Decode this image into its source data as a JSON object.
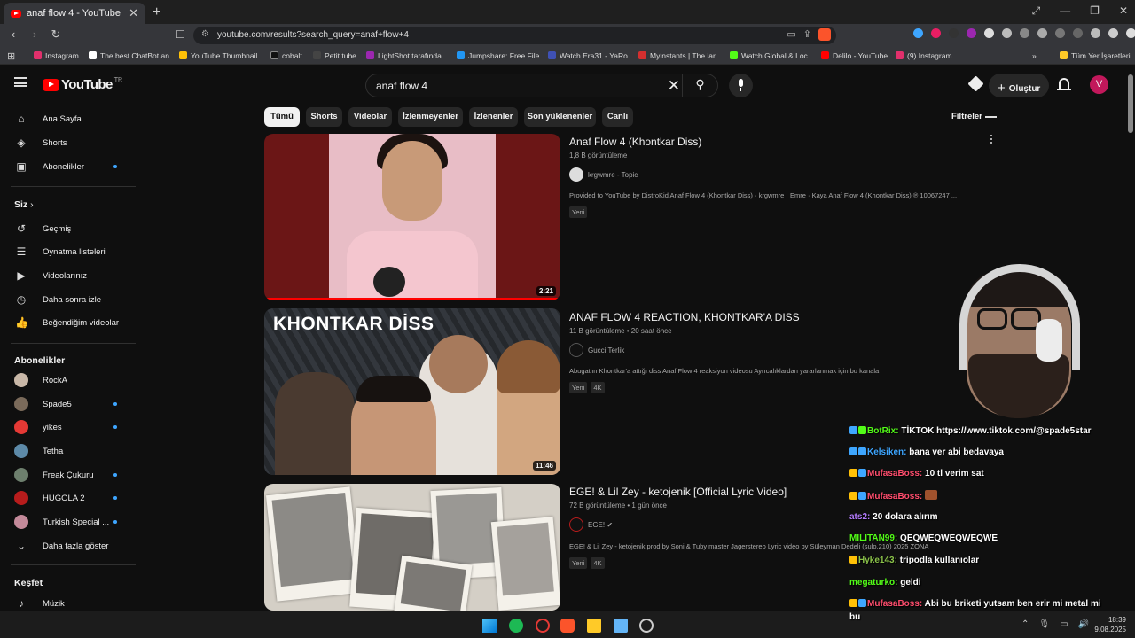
{
  "browser": {
    "tab_title": "anaf flow 4 - YouTube",
    "new_tab": "+",
    "url": "youtube.com/results?search_query=anaf+flow+4",
    "bookmarks": [
      {
        "label": "Instagram",
        "color": "#e1306c"
      },
      {
        "label": "The best ChatBot an...",
        "color": "#ffffff"
      },
      {
        "label": "YouTube Thumbnail...",
        "color": "#ffc107"
      },
      {
        "label": "cobalt",
        "color": "#222222"
      },
      {
        "label": "Petit tube",
        "color": "#444444"
      },
      {
        "label": "LightShot tarafında...",
        "color": "#9c27b0"
      },
      {
        "label": "Jumpshare: Free File...",
        "color": "#2196f3"
      },
      {
        "label": "Watch Era31 - YaRo...",
        "color": "#3f51b5"
      },
      {
        "label": "Myinstants | The lar...",
        "color": "#d32f2f"
      },
      {
        "label": "Watch Global & Loc...",
        "color": "#53fc18"
      },
      {
        "label": "Delilo - YouTube",
        "color": "#ff0000"
      },
      {
        "label": "(9) Instagram",
        "color": "#e1306c"
      }
    ],
    "all_bookmarks": "Tüm Yer İşaretleri",
    "chevron": "»"
  },
  "header": {
    "logo_text": "YouTube",
    "country_code": "TR",
    "search_value": "anaf flow 4",
    "create_label": "Oluştur",
    "avatar_letter": "V"
  },
  "sidebar": {
    "main": [
      {
        "label": "Ana Sayfa",
        "icon": "home-icon",
        "glyph": "⌂"
      },
      {
        "label": "Shorts",
        "icon": "shorts-icon",
        "glyph": "◈"
      },
      {
        "label": "Abonelikler",
        "icon": "subscriptions-icon",
        "glyph": "▣",
        "dot": true
      }
    ],
    "you_heading": "Siz",
    "you": [
      {
        "label": "Geçmiş",
        "icon": "history-icon",
        "glyph": "↺"
      },
      {
        "label": "Oynatma listeleri",
        "icon": "playlists-icon",
        "glyph": "☰"
      },
      {
        "label": "Videolarınız",
        "icon": "your-videos-icon",
        "glyph": "▶"
      },
      {
        "label": "Daha sonra izle",
        "icon": "watch-later-icon",
        "glyph": "◷"
      },
      {
        "label": "Beğendiğim videolar",
        "icon": "liked-videos-icon",
        "glyph": "👍"
      }
    ],
    "subs_heading": "Abonelikler",
    "subscriptions": [
      {
        "label": "RockA",
        "color": "#c9b8a8",
        "dot": false
      },
      {
        "label": "Spade5",
        "color": "#7a6a5a",
        "dot": true
      },
      {
        "label": "yikes",
        "color": "#e53935",
        "dot": true
      },
      {
        "label": "Tetha",
        "color": "#5d8aa8",
        "dot": false
      },
      {
        "label": "Freak Çukuru",
        "color": "#6d7f6d",
        "dot": true
      },
      {
        "label": "HUGOLA 2",
        "color": "#b71c1c",
        "dot": true
      },
      {
        "label": "Turkish Special ...",
        "color": "#c48a9a",
        "dot": true
      }
    ],
    "show_more": "Daha fazla göster",
    "explore_heading": "Keşfet",
    "explore": [
      {
        "label": "Müzik",
        "icon": "music-icon",
        "glyph": "♪"
      }
    ]
  },
  "chips": [
    "Tümü",
    "Shorts",
    "Videolar",
    "İzlenmeyenler",
    "İzlenenler",
    "Son yüklenenler",
    "Canlı"
  ],
  "filters_label": "Filtreler",
  "results": [
    {
      "title": "Anaf Flow 4 (Khontkar Diss)",
      "meta": "1,8 B görüntüleme",
      "channel": "krgwmre - Topic",
      "channel_color": "#dddddd",
      "desc": "Provided to YouTube by DistroKid Anaf Flow 4 (Khontkar Diss) · krgwmre · Emre · Kaya Anaf Flow 4 (Khontkar Diss) ℗ 10067247 ...",
      "badges": [
        "Yeni"
      ],
      "duration": "2:21"
    },
    {
      "title": "ANAF FLOW 4 REACTION, KHONTKAR'A DISS",
      "meta": "11 B görüntüleme • 20 saat önce",
      "channel": "Gucci Terlik",
      "channel_color": "#111111",
      "desc": "Abugat'ın Khontkar'a attığı diss Anaf Flow 4 reaksiyon videosu Ayrıcalıklardan yararlanmak için bu kanala",
      "badges": [
        "Yeni",
        "4K"
      ],
      "duration": "11:46",
      "thumb_text": "KHONTKAR DİSS"
    },
    {
      "title": "EGE! & Lil Zey - ketojenik [Official Lyric Video]",
      "meta": "72 B görüntüleme • 1 gün önce",
      "channel": "EGE! ✔",
      "channel_color": "#111111",
      "desc": "EGE! & Lil Zey - ketojenik prod by Soni & Tuby master Jagerstereo Lyric video by Süleyman Dedeli (sulo.210) 2025 ZONA",
      "badges": [
        "Yeni",
        "4K"
      ]
    }
  ],
  "chat": [
    {
      "user": "BotRix:",
      "text": "TİKTOK https://www.tiktok.com/@spade5star",
      "color": "#53fc18",
      "badges": [
        "#3ea6ff",
        "#53fc18"
      ]
    },
    {
      "user": "Kelsiken:",
      "text": "bana ver abi bedavaya",
      "color": "#3ea6ff",
      "badges": [
        "#3ea6ff",
        "#3ea6ff"
      ]
    },
    {
      "user": "MufasaBoss:",
      "text": "10 tl verim sat",
      "color": "#ff4d6d",
      "badges": [
        "#ffc107",
        "#3ea6ff"
      ]
    },
    {
      "user": "MufasaBoss:",
      "text": "",
      "color": "#ff4d6d",
      "badges": [
        "#ffc107",
        "#3ea6ff"
      ],
      "emote": true
    },
    {
      "user": "ats2:",
      "text": "20 dolara alırım",
      "color": "#b57cff",
      "badges": []
    },
    {
      "user": "MILITAN99:",
      "text": "QEQWEQWEQWEQWE",
      "color": "#53fc18",
      "badges": []
    },
    {
      "user": "Hyke143:",
      "text": "tripodla kullanıolar",
      "color": "#8bc34a",
      "badges": [
        "#ffc107"
      ]
    },
    {
      "user": "megaturko:",
      "text": "geldi",
      "color": "#53fc18",
      "badges": []
    },
    {
      "user": "MufasaBoss:",
      "text": "Abi bu briketi yutsam ben erir mi metal mi",
      "color": "#ff4d6d",
      "badges": [
        "#ffc107",
        "#3ea6ff"
      ]
    },
    {
      "user": "",
      "text": "bu",
      "color": "#ffffff",
      "badges": []
    }
  ],
  "taskbar": {
    "time": "18:39",
    "date": "9.08.2025"
  }
}
